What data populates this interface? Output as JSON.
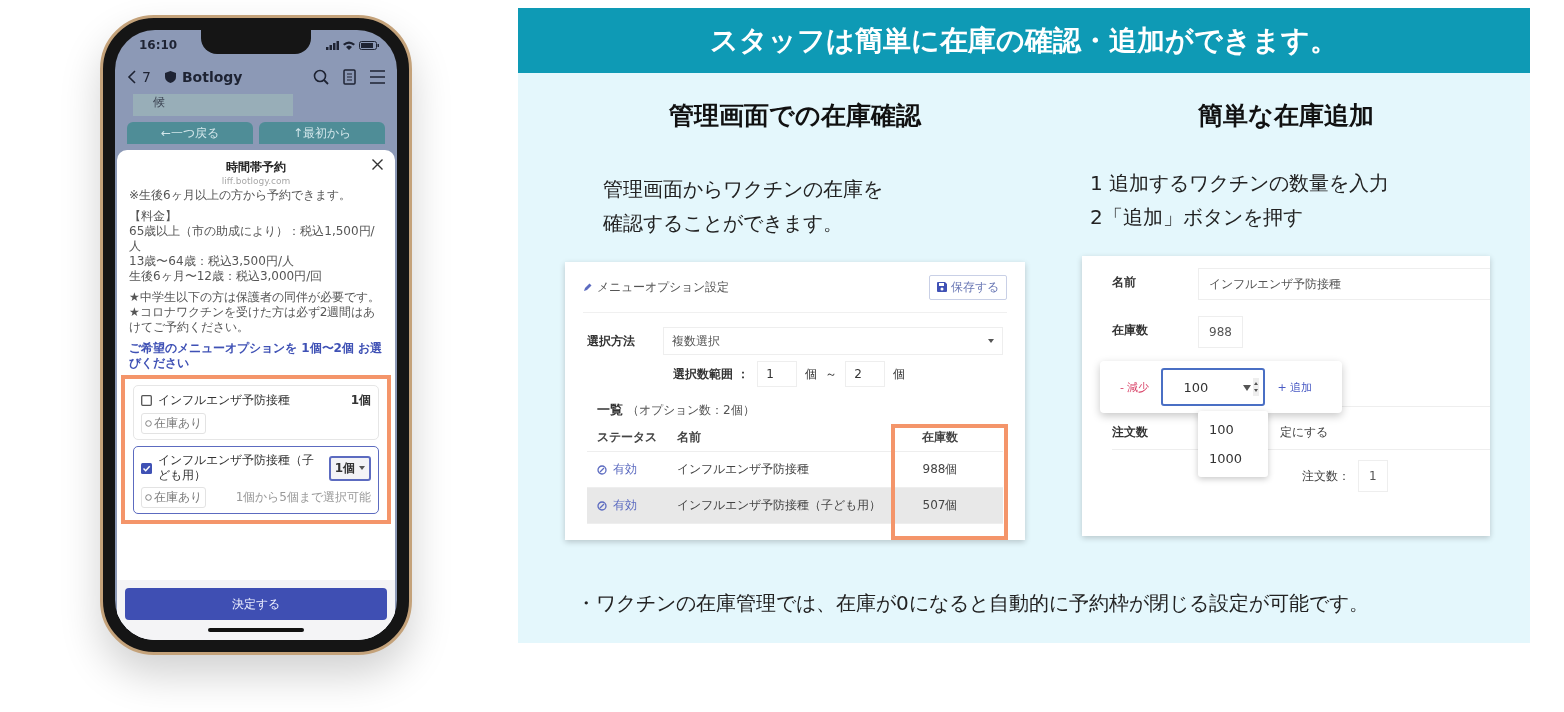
{
  "phone": {
    "status_bar": {
      "time": "16:10"
    },
    "nav_bar": {
      "back_count": "7",
      "title": "Botlogy"
    },
    "chat": {
      "card_text": "候",
      "buttons": [
        "←一つ戻る",
        "↑最初から"
      ]
    },
    "sheet": {
      "title": "時間帯予約",
      "subtitle": "liff.botlogy.com",
      "paragraphs": [
        {
          "lines": [
            "※生後6ヶ月以上の方から予約できます。"
          ]
        },
        {
          "lines": [
            "【料金】",
            "65歳以上（市の助成により）：税込1,500円/人",
            "13歳〜64歳：税込3,500円/人",
            "生後6ヶ月〜12歳：税込3,000円/回"
          ]
        },
        {
          "lines": [
            "★中学生以下の方は保護者の同伴が必要です。",
            "★コロナワクチンを受けた方は必ず2週間はあけてご予約ください。"
          ]
        }
      ],
      "options_heading": "ご希望のメニューオプションを 1個〜2個 お選びください",
      "options": [
        {
          "kind": "plain",
          "name": "インフルエンザ予防接種",
          "checked": false,
          "quantity": "1個",
          "stock_badge": "在庫あり"
        },
        {
          "kind": "select",
          "name": "インフルエンザ予防接種（子ども用）",
          "checked": true,
          "quantity": "1個",
          "stock_badge": "在庫あり",
          "note": "1個から5個まで選択可能"
        }
      ],
      "submit": "決定する"
    }
  },
  "panel": {
    "title": "スタッフは簡単に在庫の確認・追加ができます。",
    "stock_check": {
      "heading": "管理画面での在庫確認",
      "description": [
        "管理画面からワクチンの在庫を",
        "確認することができます。"
      ],
      "card": {
        "title": "メニューオプション設定",
        "save_button": "保存する",
        "method_label": "選択方法",
        "method_value": "複数選択",
        "range_label": "選択数範囲 ：",
        "range_min": "1",
        "range_min_unit": "個",
        "range_separator": "～",
        "range_max": "2",
        "range_max_unit": "個",
        "list_title": "一覧",
        "list_count": "（オプション数：2個）",
        "columns": [
          "ステータス",
          "名前",
          "在庫数"
        ],
        "rows": [
          {
            "status": "有効",
            "name": "インフルエンザ予防接種",
            "stock": "988個",
            "selected": false
          },
          {
            "status": "有効",
            "name": "インフルエンザ予防接種（子ども用）",
            "stock": "507個",
            "selected": true
          }
        ]
      }
    },
    "stock_add": {
      "heading": "簡単な在庫追加",
      "steps": [
        "1 追加するワクチンの数量を入力",
        "2「追加」ボタンを押す"
      ],
      "card": {
        "name_label": "名前",
        "name_value": "インフルエンザ予防接種",
        "stock_label": "在庫数",
        "stock_value": "988",
        "adjuster": {
          "decrease": "- 減少",
          "amount": "100",
          "increase": "+ 追加"
        },
        "amount_options": [
          "100",
          "1000"
        ],
        "order_label": "注文数",
        "order_setting": "定にする",
        "order_count_label": "注文数：",
        "order_count": "1"
      }
    },
    "footnote": "・ワクチンの在庫管理では、在庫が0になると自動的に予約枠が閉じる設定が可能です。"
  }
}
